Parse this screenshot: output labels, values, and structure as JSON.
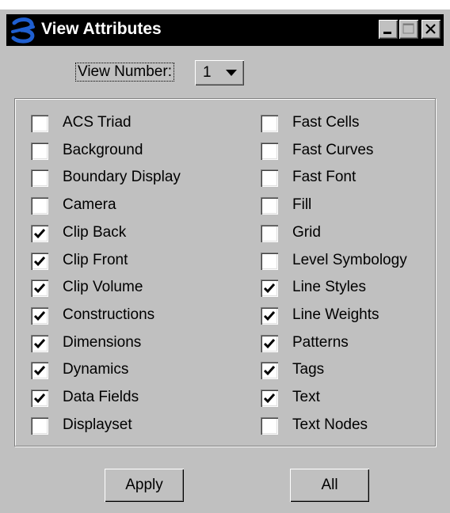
{
  "window": {
    "title": "View Attributes",
    "colors": {
      "face": "#c0c0c0",
      "titlebar": "#000000",
      "icon": "#1f5fd0"
    }
  },
  "view_number": {
    "label": "View Number:",
    "value": "1"
  },
  "attributes_left": [
    {
      "label": "ACS Triad",
      "checked": false
    },
    {
      "label": "Background",
      "checked": false
    },
    {
      "label": "Boundary Display",
      "checked": false
    },
    {
      "label": "Camera",
      "checked": false
    },
    {
      "label": "Clip Back",
      "checked": true
    },
    {
      "label": "Clip Front",
      "checked": true
    },
    {
      "label": "Clip Volume",
      "checked": true
    },
    {
      "label": "Constructions",
      "checked": true
    },
    {
      "label": "Dimensions",
      "checked": true
    },
    {
      "label": "Dynamics",
      "checked": true
    },
    {
      "label": "Data Fields",
      "checked": true
    },
    {
      "label": "Displayset",
      "checked": false
    }
  ],
  "attributes_right": [
    {
      "label": "Fast Cells",
      "checked": false
    },
    {
      "label": "Fast Curves",
      "checked": false
    },
    {
      "label": "Fast Font",
      "checked": false
    },
    {
      "label": "Fill",
      "checked": false
    },
    {
      "label": "Grid",
      "checked": false
    },
    {
      "label": "Level Symbology",
      "checked": false
    },
    {
      "label": "Line Styles",
      "checked": true
    },
    {
      "label": "Line Weights",
      "checked": true
    },
    {
      "label": "Patterns",
      "checked": true
    },
    {
      "label": "Tags",
      "checked": true
    },
    {
      "label": "Text",
      "checked": true
    },
    {
      "label": "Text Nodes",
      "checked": false
    }
  ],
  "buttons": {
    "apply": "Apply",
    "all": "All"
  }
}
